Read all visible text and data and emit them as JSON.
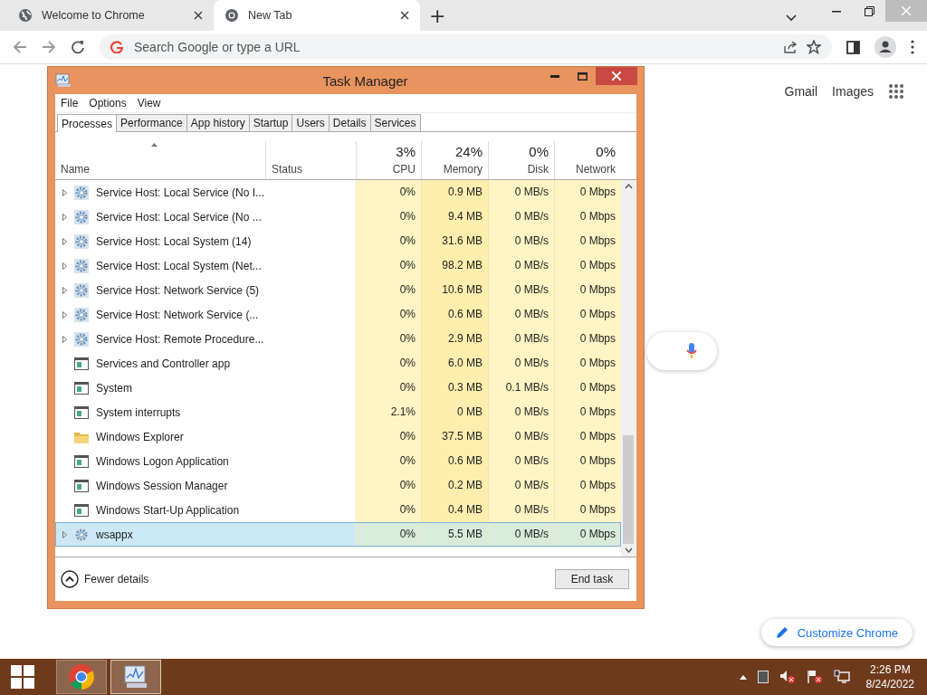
{
  "browser": {
    "tabs": [
      {
        "title": "Welcome to Chrome",
        "selected": false
      },
      {
        "title": "New Tab",
        "selected": true
      }
    ],
    "new_tab_button": "+",
    "omnibox": {
      "placeholder": "Search Google or type a URL"
    },
    "links": [
      "Gmail",
      "Images"
    ],
    "customize_button": "Customize Chrome"
  },
  "task_manager": {
    "title": "Task Manager",
    "menu": [
      "File",
      "Options",
      "View"
    ],
    "tabs": [
      {
        "label": "Processes",
        "selected": true
      },
      {
        "label": "Performance",
        "selected": false
      },
      {
        "label": "App history",
        "selected": false
      },
      {
        "label": "Startup",
        "selected": false
      },
      {
        "label": "Users",
        "selected": false
      },
      {
        "label": "Details",
        "selected": false
      },
      {
        "label": "Services",
        "selected": false
      }
    ],
    "columns": [
      {
        "label": "Name"
      },
      {
        "label": "Status"
      },
      {
        "label": "CPU",
        "total": "3%"
      },
      {
        "label": "Memory",
        "total": "24%"
      },
      {
        "label": "Disk",
        "total": "0%"
      },
      {
        "label": "Network",
        "total": "0%"
      }
    ],
    "rows": [
      {
        "name": "Service Host: Local Service (No I...",
        "kind": "service",
        "expandable": true,
        "selected": false,
        "cpu": "0%",
        "memory": "0.9 MB",
        "disk": "0 MB/s",
        "network": "0 Mbps"
      },
      {
        "name": "Service Host: Local Service (No ...",
        "kind": "service",
        "expandable": true,
        "selected": false,
        "cpu": "0%",
        "memory": "9.4 MB",
        "disk": "0 MB/s",
        "network": "0 Mbps"
      },
      {
        "name": "Service Host: Local System (14)",
        "kind": "service",
        "expandable": true,
        "selected": false,
        "cpu": "0%",
        "memory": "31.6 MB",
        "disk": "0 MB/s",
        "network": "0 Mbps"
      },
      {
        "name": "Service Host: Local System (Net...",
        "kind": "service",
        "expandable": true,
        "selected": false,
        "cpu": "0%",
        "memory": "98.2 MB",
        "disk": "0 MB/s",
        "network": "0 Mbps"
      },
      {
        "name": "Service Host: Network Service (5)",
        "kind": "service",
        "expandable": true,
        "selected": false,
        "cpu": "0%",
        "memory": "10.6 MB",
        "disk": "0 MB/s",
        "network": "0 Mbps"
      },
      {
        "name": "Service Host: Network Service (...",
        "kind": "service",
        "expandable": true,
        "selected": false,
        "cpu": "0%",
        "memory": "0.6 MB",
        "disk": "0 MB/s",
        "network": "0 Mbps"
      },
      {
        "name": "Service Host: Remote Procedure...",
        "kind": "service",
        "expandable": true,
        "selected": false,
        "cpu": "0%",
        "memory": "2.9 MB",
        "disk": "0 MB/s",
        "network": "0 Mbps"
      },
      {
        "name": "Services and Controller app",
        "kind": "app",
        "expandable": false,
        "selected": false,
        "cpu": "0%",
        "memory": "6.0 MB",
        "disk": "0 MB/s",
        "network": "0 Mbps"
      },
      {
        "name": "System",
        "kind": "app",
        "expandable": false,
        "selected": false,
        "cpu": "0%",
        "memory": "0.3 MB",
        "disk": "0.1 MB/s",
        "network": "0 Mbps"
      },
      {
        "name": "System interrupts",
        "kind": "app",
        "expandable": false,
        "selected": false,
        "cpu": "2.1%",
        "memory": "0 MB",
        "disk": "0 MB/s",
        "network": "0 Mbps"
      },
      {
        "name": "Windows Explorer",
        "kind": "folder",
        "expandable": false,
        "selected": false,
        "cpu": "0%",
        "memory": "37.5 MB",
        "disk": "0 MB/s",
        "network": "0 Mbps"
      },
      {
        "name": "Windows Logon Application",
        "kind": "app",
        "expandable": false,
        "selected": false,
        "cpu": "0%",
        "memory": "0.6 MB",
        "disk": "0 MB/s",
        "network": "0 Mbps"
      },
      {
        "name": "Windows Session Manager",
        "kind": "app",
        "expandable": false,
        "selected": false,
        "cpu": "0%",
        "memory": "0.2 MB",
        "disk": "0 MB/s",
        "network": "0 Mbps"
      },
      {
        "name": "Windows Start-Up Application",
        "kind": "app",
        "expandable": false,
        "selected": false,
        "cpu": "0%",
        "memory": "0.4 MB",
        "disk": "0 MB/s",
        "network": "0 Mbps"
      },
      {
        "name": "wsappx",
        "kind": "service",
        "expandable": true,
        "selected": true,
        "cpu": "0%",
        "memory": "5.5 MB",
        "disk": "0 MB/s",
        "network": "0 Mbps"
      }
    ],
    "fewer_details": "Fewer details",
    "end_task": "End task"
  },
  "taskbar": {
    "time": "2:26 PM",
    "date": "8/24/2022"
  }
}
